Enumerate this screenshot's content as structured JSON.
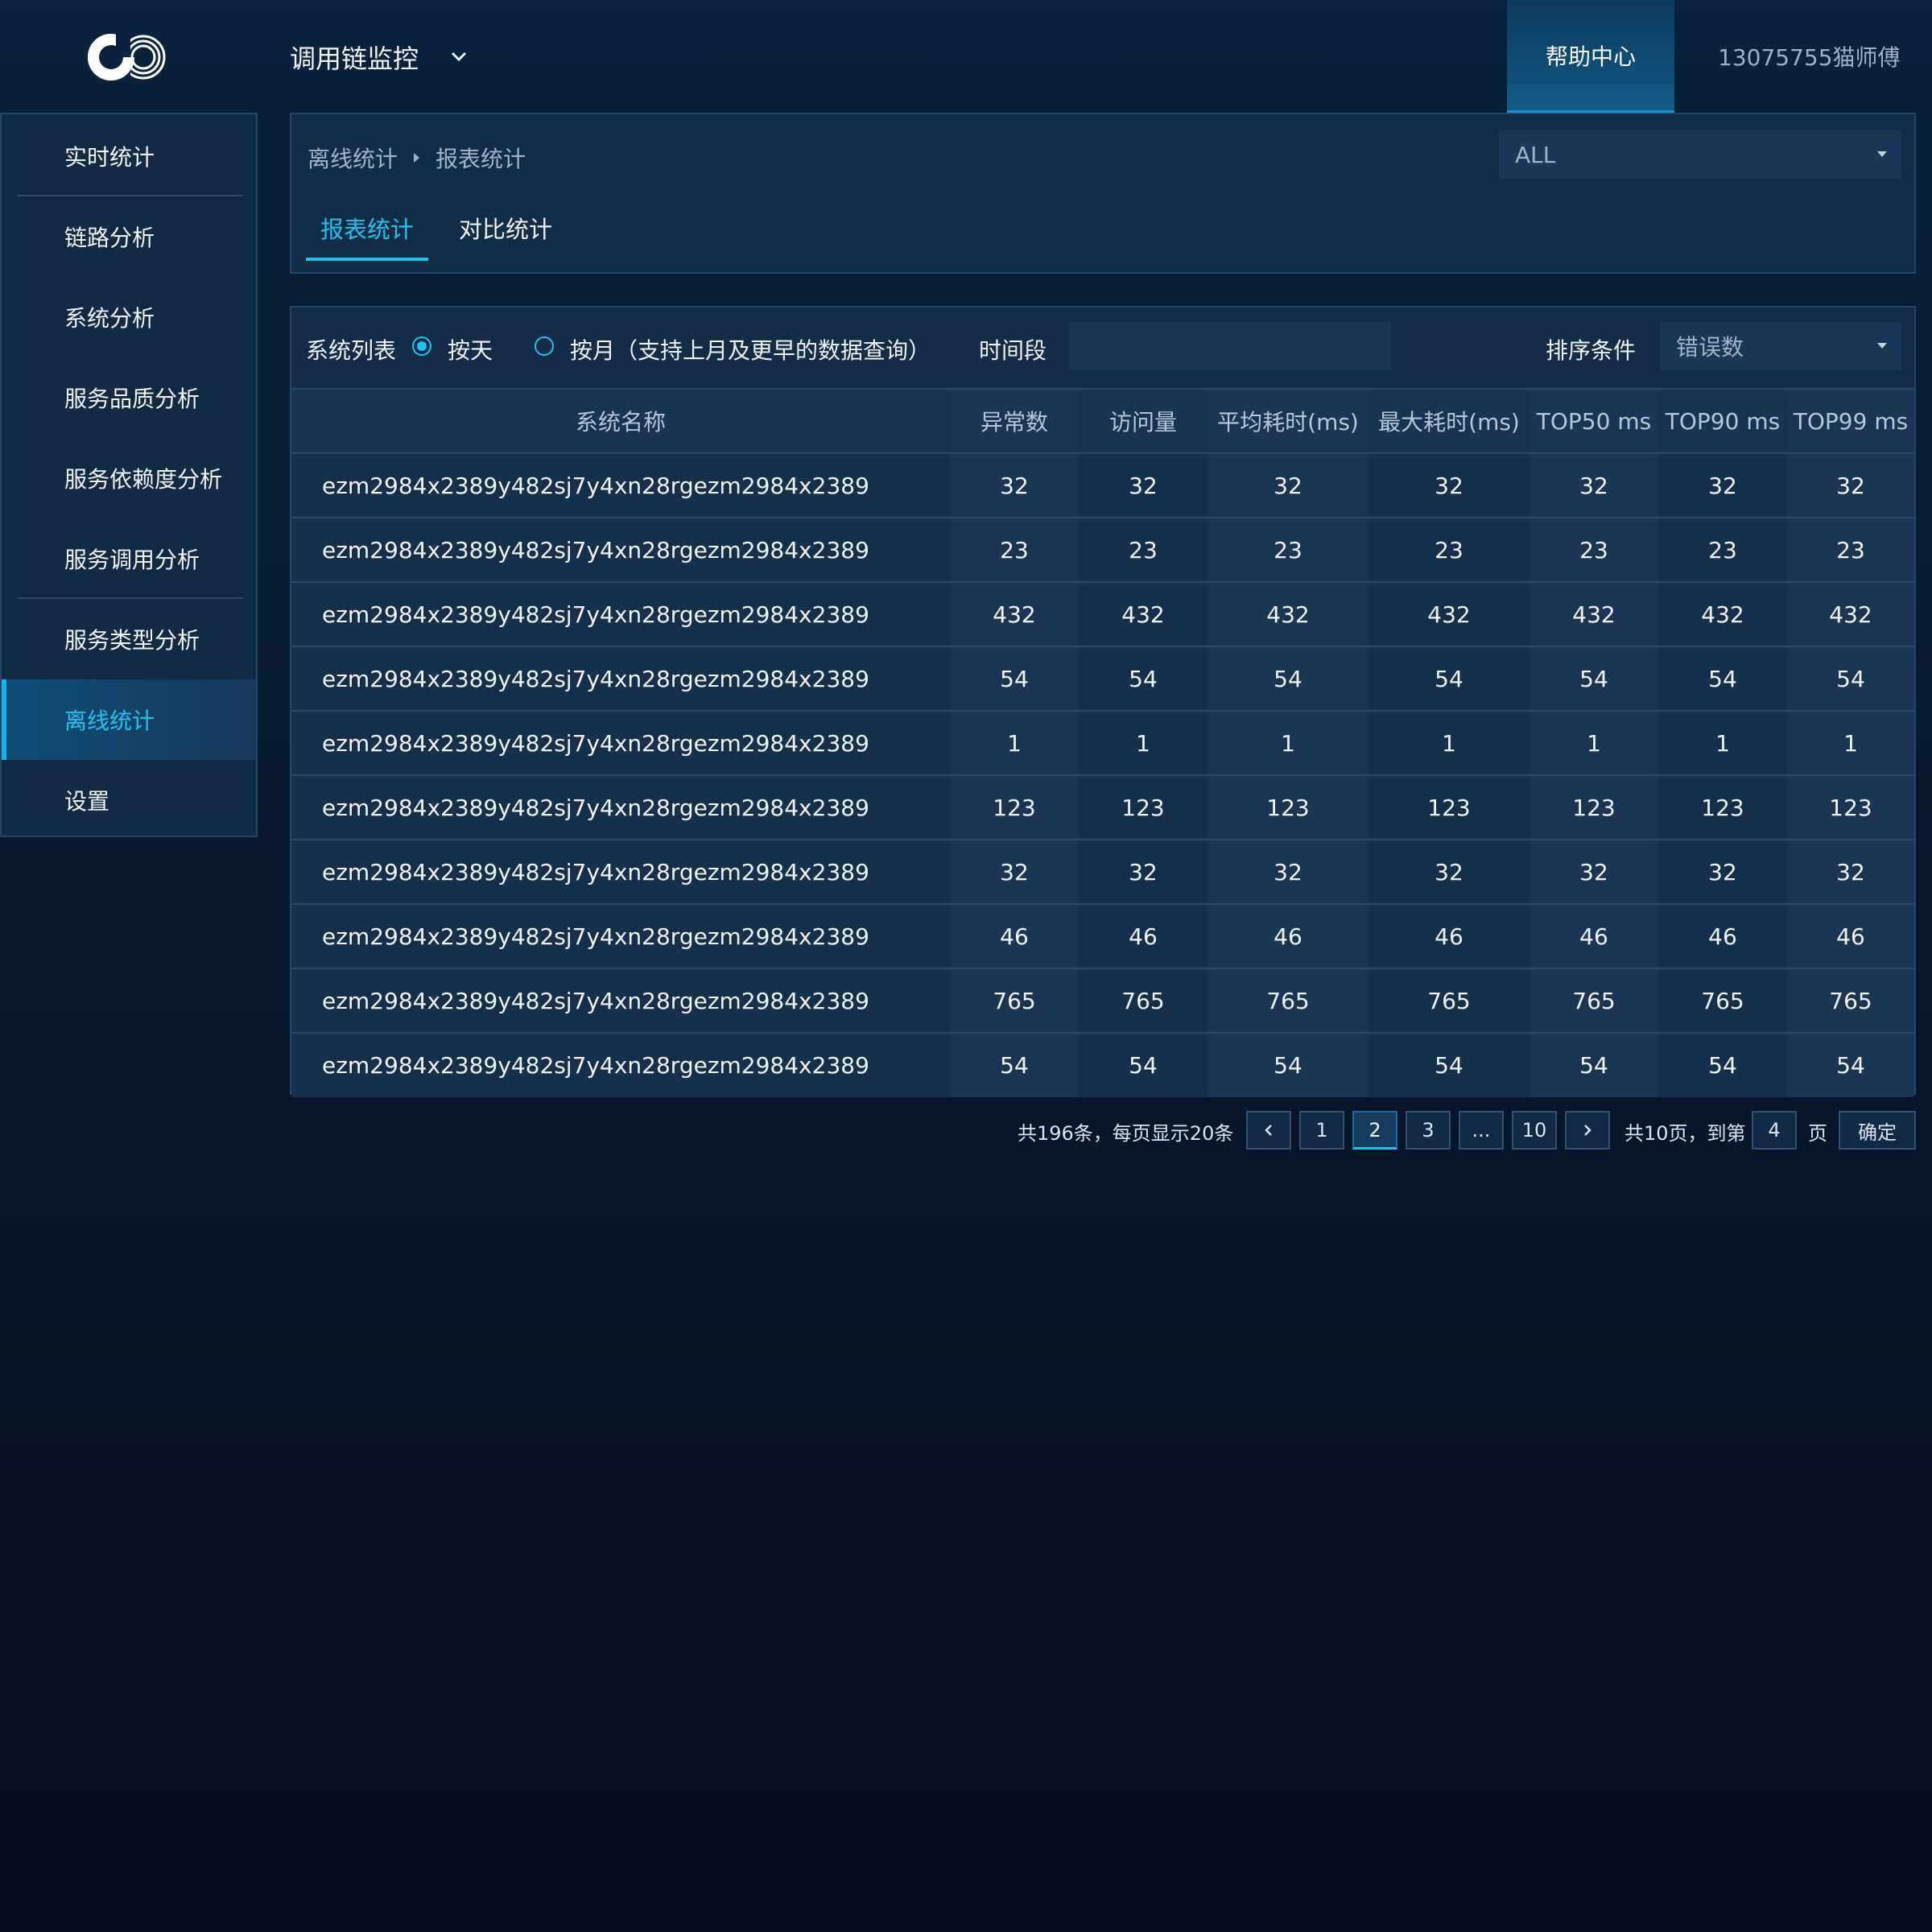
{
  "header": {
    "app_title": "调用链监控",
    "help_label": "帮助中心",
    "user_label": "13075755猫师傅"
  },
  "sidebar": {
    "items": [
      {
        "label": "实时统计"
      },
      {
        "label": "链路分析"
      },
      {
        "label": "系统分析"
      },
      {
        "label": "服务品质分析"
      },
      {
        "label": "服务依赖度分析"
      },
      {
        "label": "服务调用分析"
      },
      {
        "label": "服务类型分析"
      },
      {
        "label": "离线统计"
      },
      {
        "label": "设置"
      }
    ],
    "active_index": 7
  },
  "breadcrumb": {
    "items": [
      "离线统计",
      "报表统计"
    ],
    "scope_select": "ALL"
  },
  "tabs": [
    {
      "label": "报表统计",
      "active": true
    },
    {
      "label": "对比统计",
      "active": false
    }
  ],
  "filters": {
    "list_label": "系统列表",
    "by_day_label": "按天",
    "by_month_label": "按月（支持上月及更早的数据查询）",
    "time_label": "时间段",
    "time_value": "",
    "sort_label": "排序条件",
    "sort_value": "错误数"
  },
  "table": {
    "columns": [
      "系统名称",
      "异常数",
      "访问量",
      "平均耗时(ms)",
      "最大耗时(ms)",
      "TOP50 ms",
      "TOP90 ms",
      "TOP99 ms"
    ],
    "rows": [
      [
        "ezm2984x2389y482sj7y4xn28rgezm2984x2389",
        "32",
        "32",
        "32",
        "32",
        "32",
        "32",
        "32"
      ],
      [
        "ezm2984x2389y482sj7y4xn28rgezm2984x2389",
        "23",
        "23",
        "23",
        "23",
        "23",
        "23",
        "23"
      ],
      [
        "ezm2984x2389y482sj7y4xn28rgezm2984x2389",
        "432",
        "432",
        "432",
        "432",
        "432",
        "432",
        "432"
      ],
      [
        "ezm2984x2389y482sj7y4xn28rgezm2984x2389",
        "54",
        "54",
        "54",
        "54",
        "54",
        "54",
        "54"
      ],
      [
        "ezm2984x2389y482sj7y4xn28rgezm2984x2389",
        "1",
        "1",
        "1",
        "1",
        "1",
        "1",
        "1"
      ],
      [
        "ezm2984x2389y482sj7y4xn28rgezm2984x2389",
        "123",
        "123",
        "123",
        "123",
        "123",
        "123",
        "123"
      ],
      [
        "ezm2984x2389y482sj7y4xn28rgezm2984x2389",
        "32",
        "32",
        "32",
        "32",
        "32",
        "32",
        "32"
      ],
      [
        "ezm2984x2389y482sj7y4xn28rgezm2984x2389",
        "46",
        "46",
        "46",
        "46",
        "46",
        "46",
        "46"
      ],
      [
        "ezm2984x2389y482sj7y4xn28rgezm2984x2389",
        "765",
        "765",
        "765",
        "765",
        "765",
        "765",
        "765"
      ],
      [
        "ezm2984x2389y482sj7y4xn28rgezm2984x2389",
        "54",
        "54",
        "54",
        "54",
        "54",
        "54",
        "54"
      ]
    ]
  },
  "pagination": {
    "summary": "共196条，每页显示20条",
    "prev_icon": "chevron-left-icon",
    "pages": [
      "1",
      "2",
      "3",
      "...",
      "10"
    ],
    "current_page": "2",
    "next_icon": "chevron-right-icon",
    "total_pages_text": "共10页，到第",
    "goto_value": "4",
    "page_unit": "页",
    "confirm_label": "确定"
  },
  "colors": {
    "accent": "#1fc3ef",
    "panel": "#142c48",
    "border": "#27476a"
  }
}
